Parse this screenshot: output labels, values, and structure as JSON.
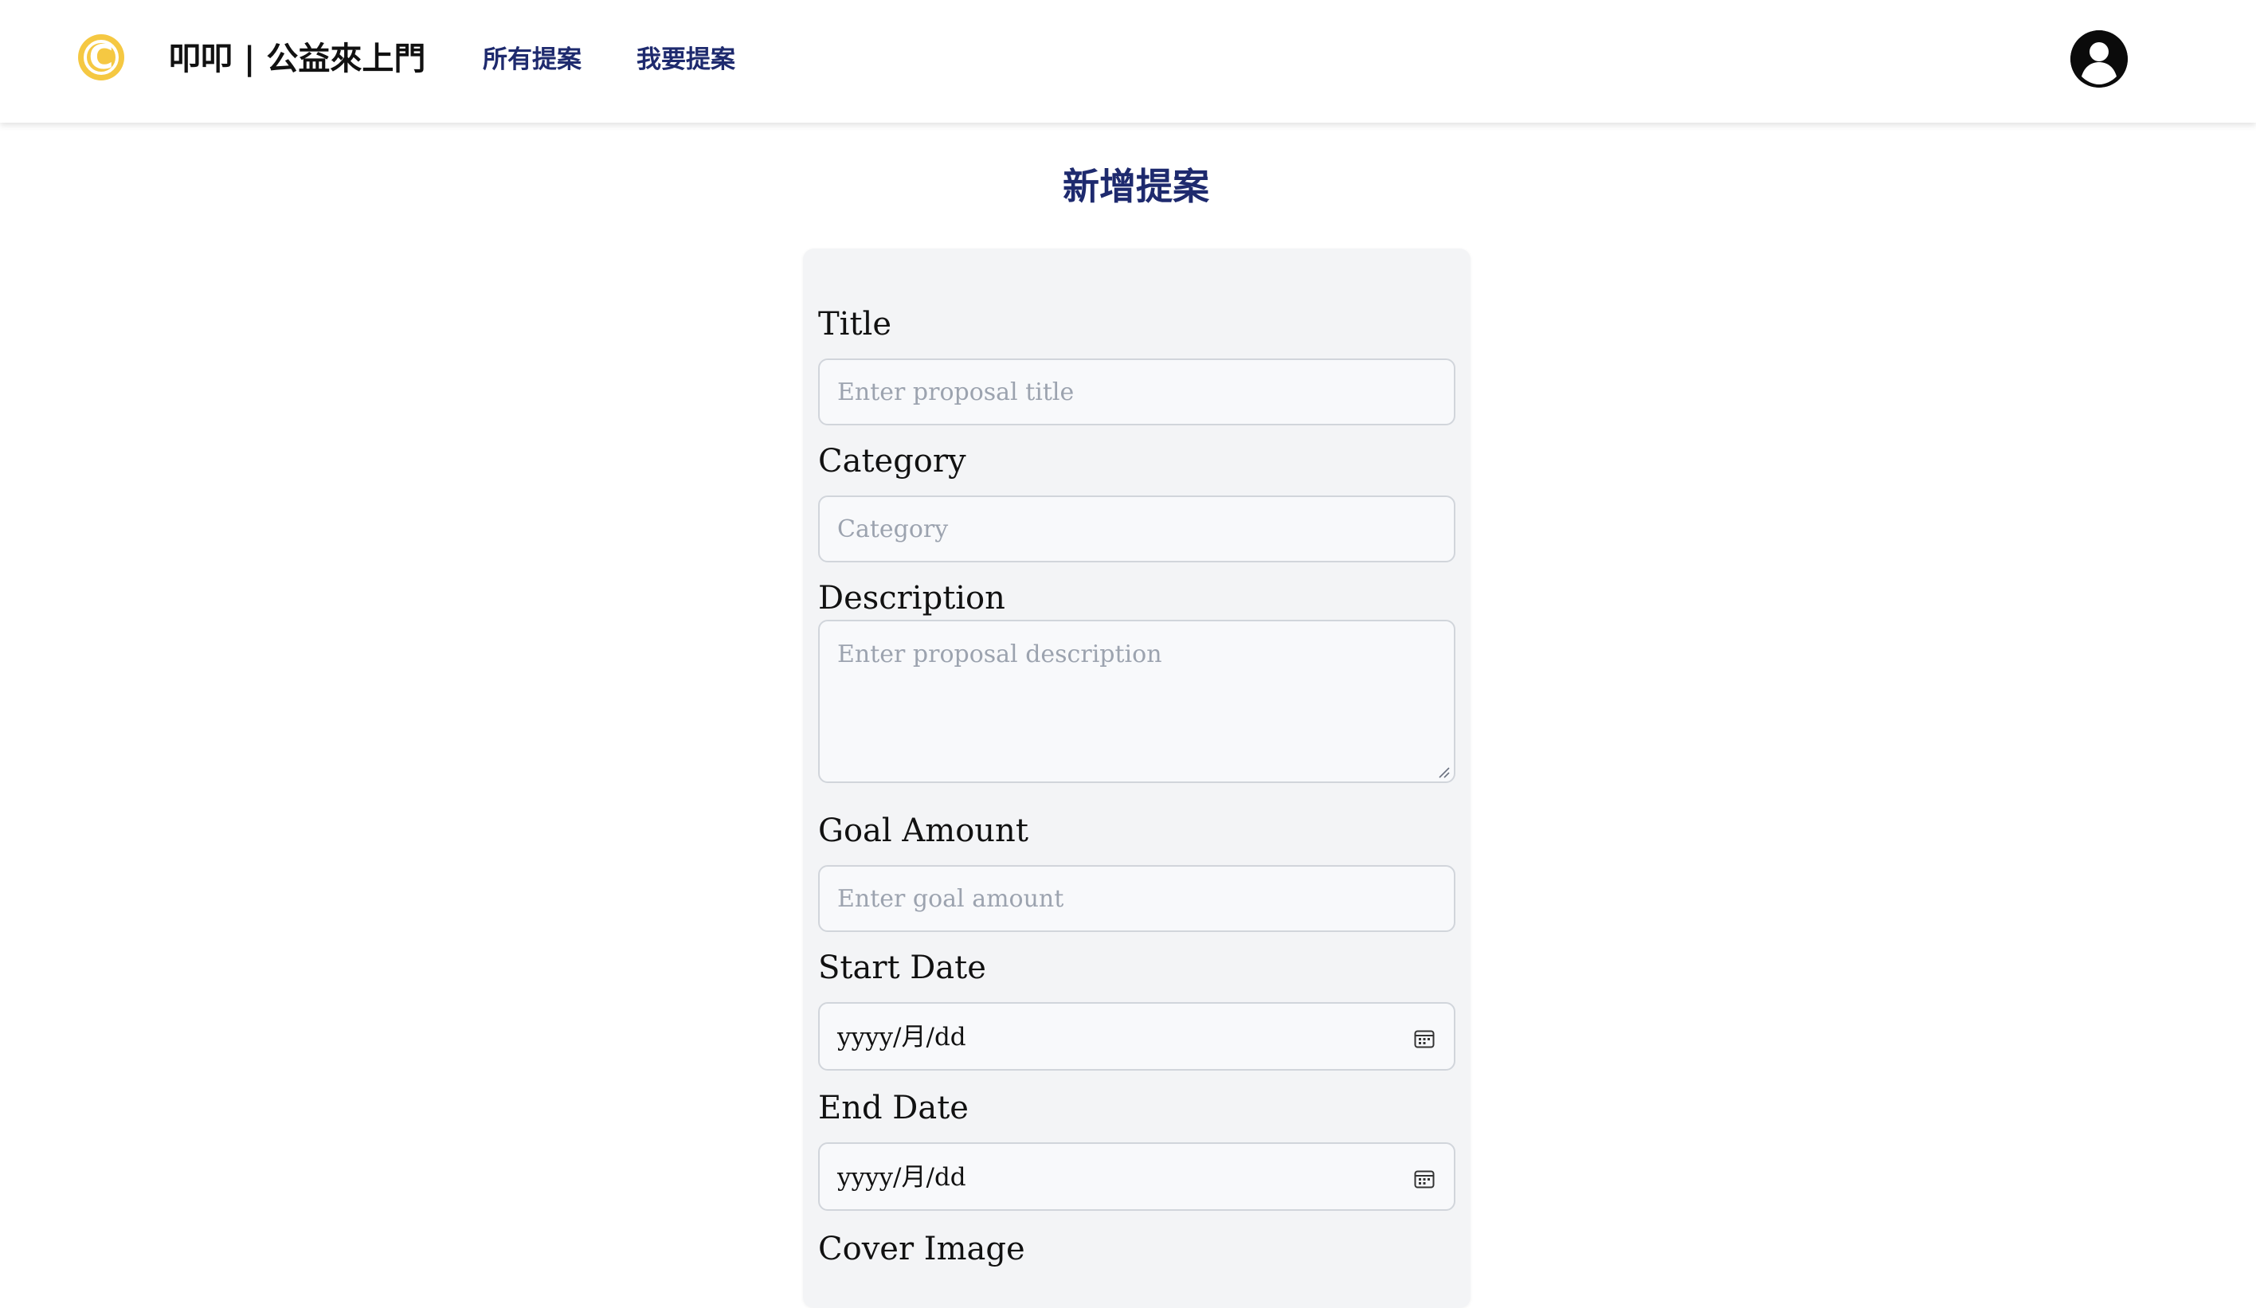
{
  "header": {
    "logo_glyph": "C",
    "brand": "叩叩 | 公益來上門",
    "nav": [
      {
        "label": "所有提案"
      },
      {
        "label": "我要提案"
      }
    ],
    "avatar_icon": "user-circle-icon",
    "accent_color": "#1e2a6e",
    "logo_color": "#f5c842"
  },
  "page": {
    "title": "新增提案"
  },
  "form": {
    "title": {
      "label": "Title",
      "placeholder": "Enter proposal title"
    },
    "category": {
      "label": "Category",
      "placeholder": "Category"
    },
    "description": {
      "label": "Description",
      "placeholder": "Enter proposal description"
    },
    "goal_amount": {
      "label": "Goal Amount",
      "placeholder": "Enter goal amount"
    },
    "start_date": {
      "label": "Start Date",
      "value": "yyyy/月/dd",
      "icon": "calendar-icon"
    },
    "end_date": {
      "label": "End Date",
      "value": "yyyy/月/dd",
      "icon": "calendar-icon"
    },
    "cover_image": {
      "label": "Cover Image"
    }
  }
}
